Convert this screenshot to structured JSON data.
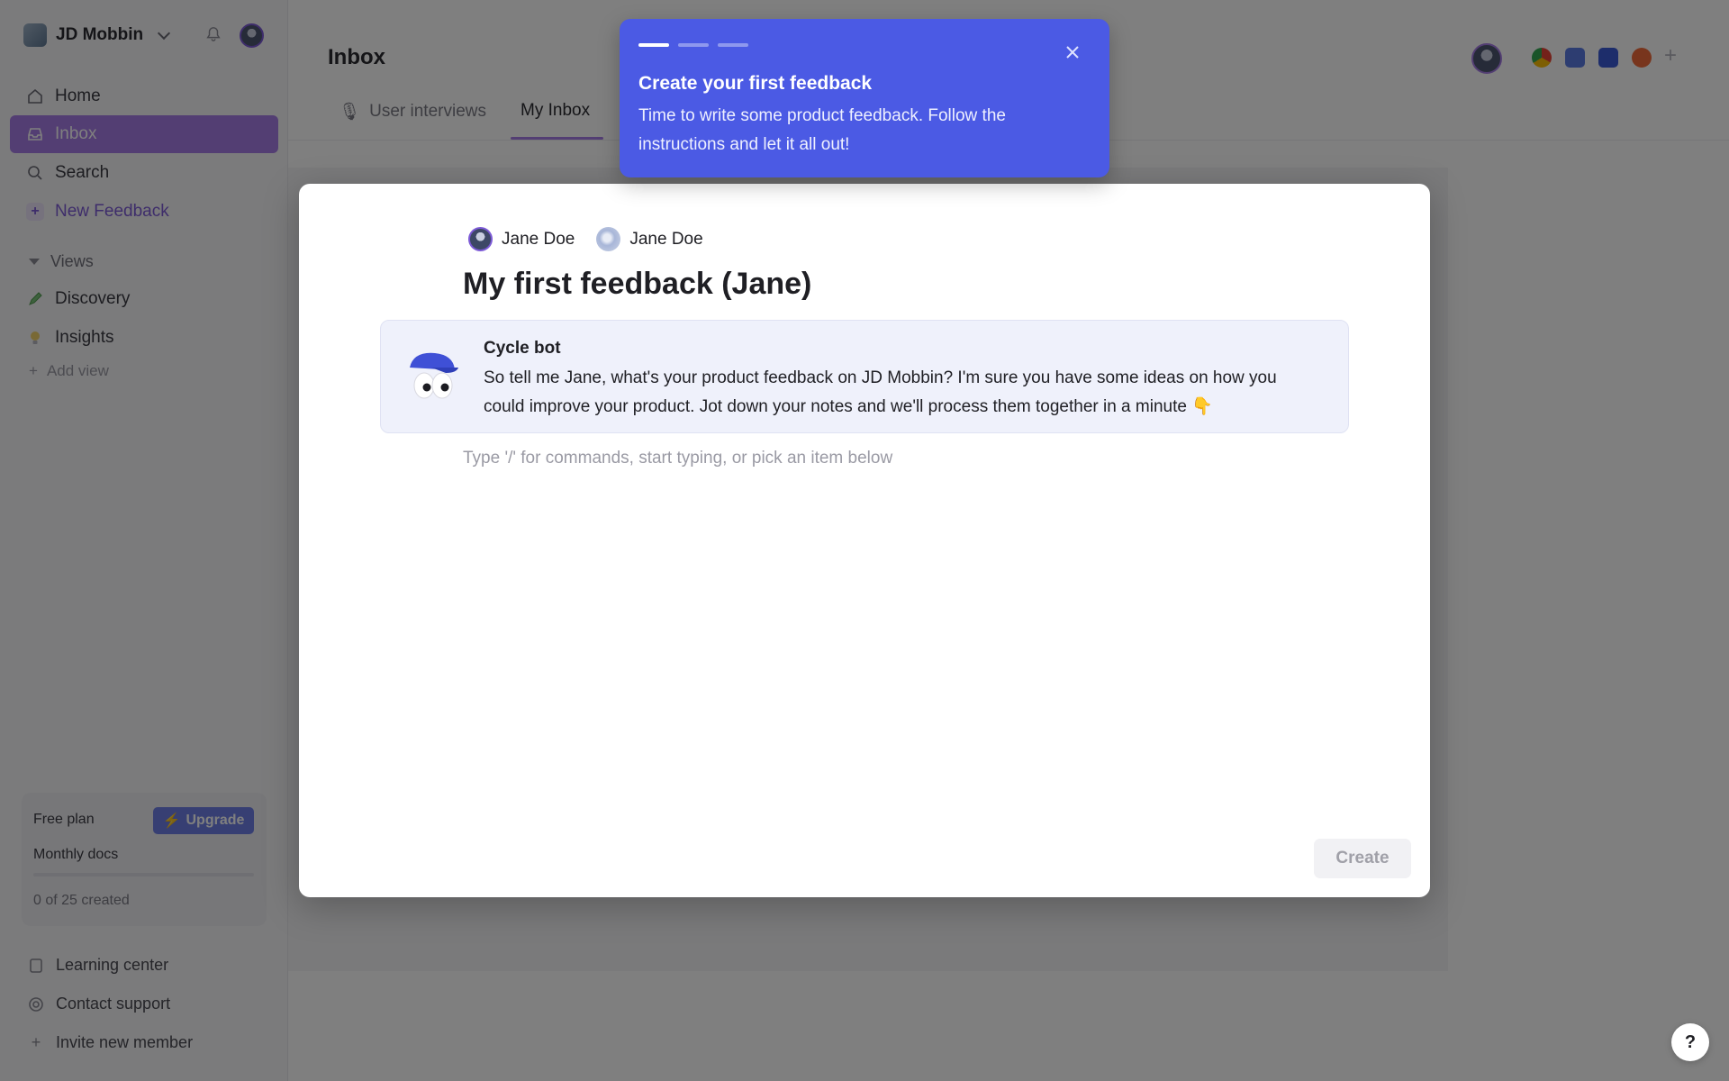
{
  "workspace": {
    "name": "JD Mobbin"
  },
  "sidebar": {
    "nav": [
      {
        "label": "Home",
        "icon": "home-icon"
      },
      {
        "label": "Inbox",
        "icon": "inbox-icon"
      },
      {
        "label": "Search",
        "icon": "search-icon"
      },
      {
        "label": "New Feedback",
        "icon": "plus-icon"
      }
    ],
    "views_label": "Views",
    "views": [
      {
        "label": "Discovery",
        "icon": "pencil-icon"
      },
      {
        "label": "Insights",
        "icon": "lightbulb-icon"
      }
    ],
    "add_view": "Add view",
    "plan": {
      "name": "Free plan",
      "upgrade": "Upgrade",
      "docs_label": "Monthly docs",
      "count": "0 of 25 created",
      "progress": 0
    },
    "footer": [
      {
        "label": "Learning center",
        "icon": "book-icon"
      },
      {
        "label": "Contact support",
        "icon": "support-icon"
      },
      {
        "label": "Invite new member",
        "icon": "plus-icon"
      }
    ]
  },
  "main": {
    "title": "Inbox",
    "tabs": [
      {
        "label": "User interviews",
        "icon": "microphone-icon"
      },
      {
        "label": "My Inbox"
      }
    ]
  },
  "modal": {
    "assignees": [
      "Jane Doe",
      "Jane Doe"
    ],
    "title": "My first feedback (Jane)",
    "bot": {
      "name": "Cycle bot",
      "message": "So tell me Jane, what's your product feedback on JD Mobbin? I'm sure you have some ideas on how you could improve your product. Jot down your notes and we'll process them together in a minute 👇"
    },
    "editor_placeholder": "Type '/' for commands, start typing, or pick an item below",
    "create": "Create"
  },
  "tooltip": {
    "title": "Create your first feedback",
    "body": "Time to write some product feedback. Follow the instructions and let it all out!",
    "steps_total": 3,
    "current_step": 1
  },
  "help": {
    "label": "?"
  },
  "colors": {
    "accent": "#a77de6",
    "tooltip": "#4b5ae4",
    "upgrade": "#6f7fe6"
  }
}
